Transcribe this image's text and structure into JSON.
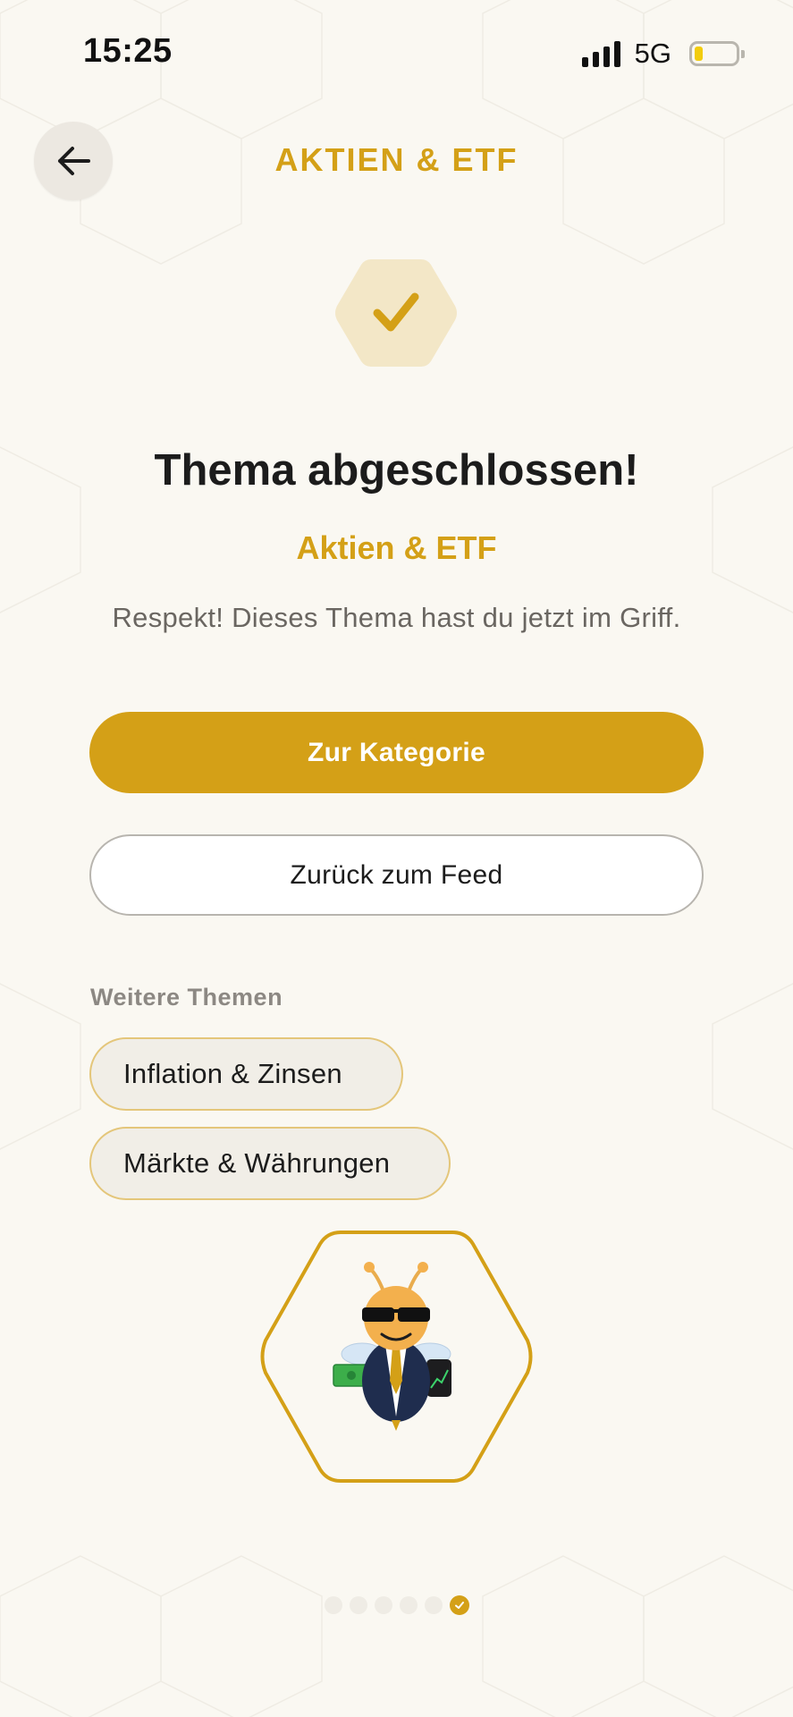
{
  "status_bar": {
    "time": "15:25",
    "network": "5G"
  },
  "header": {
    "title": "AKTIEN & ETF"
  },
  "completion": {
    "title": "Thema abgeschlossen!",
    "topic": "Aktien & ETF",
    "message": "Respekt! Dieses Thema hast du jetzt im Griff."
  },
  "actions": {
    "primary_label": "Zur Kategorie",
    "secondary_label": "Zurück zum Feed"
  },
  "more_topics": {
    "label": "Weitere Themen",
    "items": [
      {
        "label": "Inflation & Zinsen"
      },
      {
        "label": "Märkte & Währungen"
      }
    ]
  },
  "progress": {
    "total_steps": 6,
    "completed_step": 6
  },
  "colors": {
    "accent": "#d4a017",
    "background": "#faf8f2",
    "check_hex_fill": "#f3e7c7",
    "chip_border": "#e4c67a"
  },
  "icons": {
    "back": "arrow-left-icon",
    "check": "check-icon",
    "mascot": "bee-mascot-icon"
  }
}
